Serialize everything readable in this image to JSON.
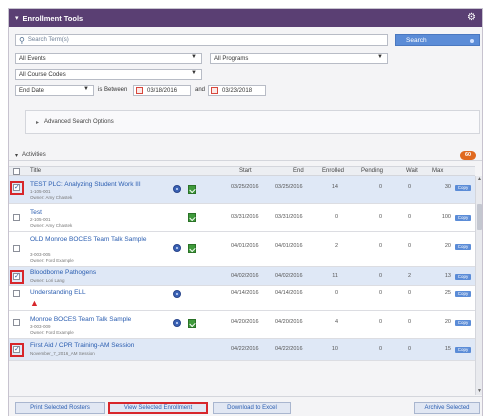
{
  "panel": {
    "title": "Enrollment Tools"
  },
  "search": {
    "placeholder": "Search Term(s)",
    "button_label": "Search"
  },
  "filters": {
    "events": "All Events",
    "programs": "All Programs",
    "course_codes": "All Course Codes",
    "date_type": "End Date",
    "between_label": "is Between",
    "start_date": "03/18/2016",
    "and_label": "and",
    "end_date": "03/23/2018"
  },
  "advanced": {
    "label": "Advanced Search Options"
  },
  "activities": {
    "label": "Activities",
    "count": "60"
  },
  "columns": {
    "title": "Title",
    "start": "Start",
    "end": "End",
    "enrolled": "Enrolled",
    "pending": "Pending",
    "wait": "Wait",
    "max": "Max"
  },
  "rows": [
    {
      "title": "TEST PLC: Analyzing Student Work III",
      "code": "1-105-001",
      "owner": "Owner: Amy Chastek",
      "start": "03/25/2016",
      "end": "03/25/2016",
      "enrolled": "14",
      "pending": "0",
      "wait": "0",
      "max": "30",
      "copy": "Copy"
    },
    {
      "title": "Test",
      "code": "2-105-001",
      "owner": "Owner: Amy Chastek",
      "start": "03/31/2016",
      "end": "03/31/2016",
      "enrolled": "0",
      "pending": "0",
      "wait": "0",
      "max": "100",
      "copy": "Copy"
    },
    {
      "title": "OLD Monroe BOCES Team Talk Sample",
      "code": "3-003-005",
      "owner": "Owner: Ford Example",
      "start": "04/01/2016",
      "end": "04/01/2016",
      "enrolled": "2",
      "pending": "0",
      "wait": "0",
      "max": "20",
      "copy": "Copy"
    },
    {
      "title": "Bloodborne Pathogens",
      "code": "",
      "owner": "Owner: Lori Lang",
      "start": "04/02/2016",
      "end": "04/02/2016",
      "enrolled": "11",
      "pending": "0",
      "wait": "2",
      "max": "13",
      "copy": "Copy"
    },
    {
      "title": "Understanding ELL",
      "code": "",
      "owner": "",
      "start": "04/14/2016",
      "end": "04/14/2016",
      "enrolled": "0",
      "pending": "0",
      "wait": "0",
      "max": "25",
      "copy": "Copy"
    },
    {
      "title": "Monroe BOCES Team Talk Sample",
      "code": "3-003-009",
      "owner": "Owner: Ford Example",
      "start": "04/20/2016",
      "end": "04/20/2016",
      "enrolled": "4",
      "pending": "0",
      "wait": "0",
      "max": "20",
      "copy": "Copy"
    },
    {
      "title": "First Aid / CPR Training-AM Session",
      "code": "November_7_2016_AM Session",
      "owner": "",
      "start": "04/22/2016",
      "end": "04/22/2016",
      "enrolled": "10",
      "pending": "0",
      "wait": "0",
      "max": "15",
      "copy": "Copy"
    }
  ],
  "footer": {
    "print_rosters": "Print Selected Rosters",
    "view_enrollment": "View Selected Enrollment",
    "download_excel": "Download to Excel",
    "archive": "Archive Selected"
  },
  "colors": {
    "header": "#5a3f73",
    "accent": "#5b8cd7",
    "highlight": "#d7262b",
    "badge": "#e0691f"
  }
}
